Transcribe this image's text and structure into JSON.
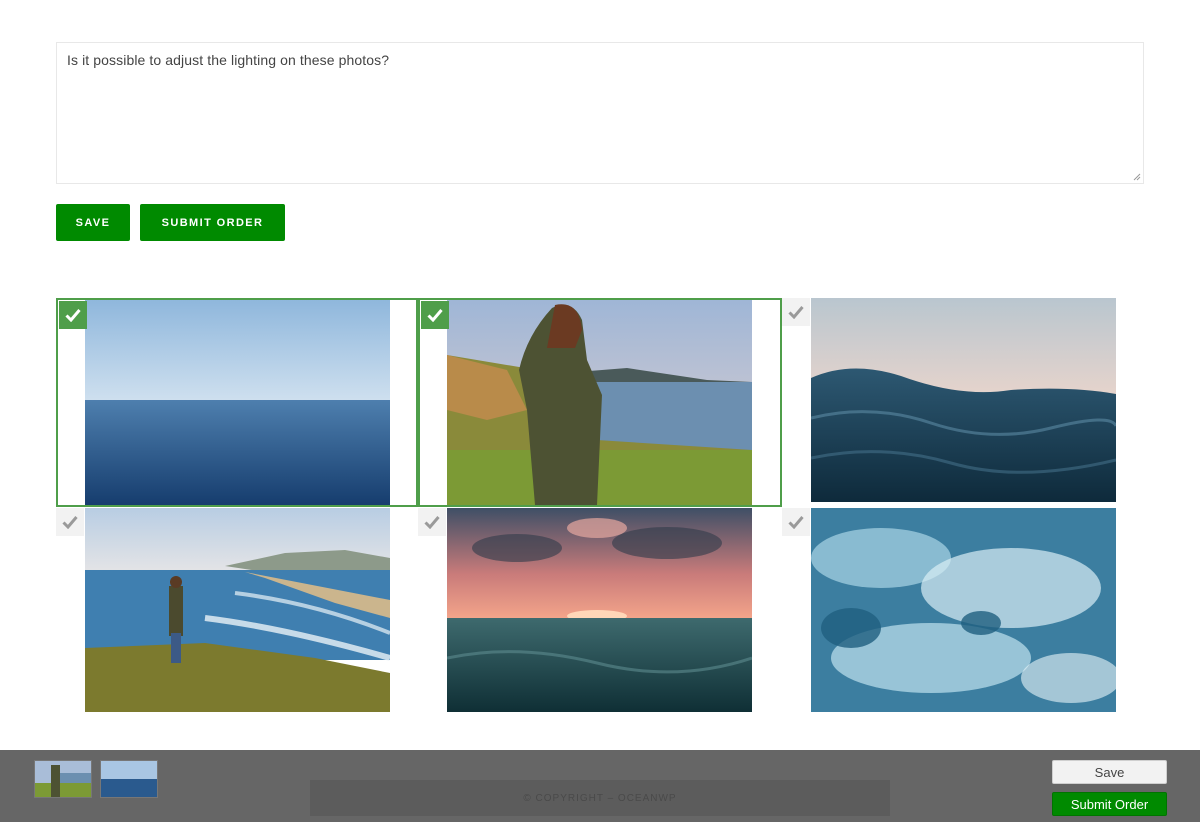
{
  "comment": {
    "text": "Is it possible to adjust the lighting on these photos?"
  },
  "actions": {
    "save_label": "SAVE",
    "submit_label": "SUBMIT ORDER"
  },
  "gallery": {
    "photos": [
      {
        "subject": "calm open sea horizon",
        "selected": true
      },
      {
        "subject": "woman on coastal cliff",
        "selected": true
      },
      {
        "subject": "close-up ocean wave",
        "selected": false
      },
      {
        "subject": "person on grassy cliff above beach",
        "selected": false
      },
      {
        "subject": "sunset over sea",
        "selected": false
      },
      {
        "subject": "foaming turquoise water",
        "selected": false
      }
    ]
  },
  "icons": {
    "check": "checkmark-icon"
  },
  "colors": {
    "accent_green": "#008a00",
    "selection_green": "#4f9e4a",
    "bottom_bar": "#666666"
  },
  "bottom_bar": {
    "save_label": "Save",
    "submit_label": "Submit Order",
    "footer_text": "© COPYRIGHT – OCEANWP"
  }
}
